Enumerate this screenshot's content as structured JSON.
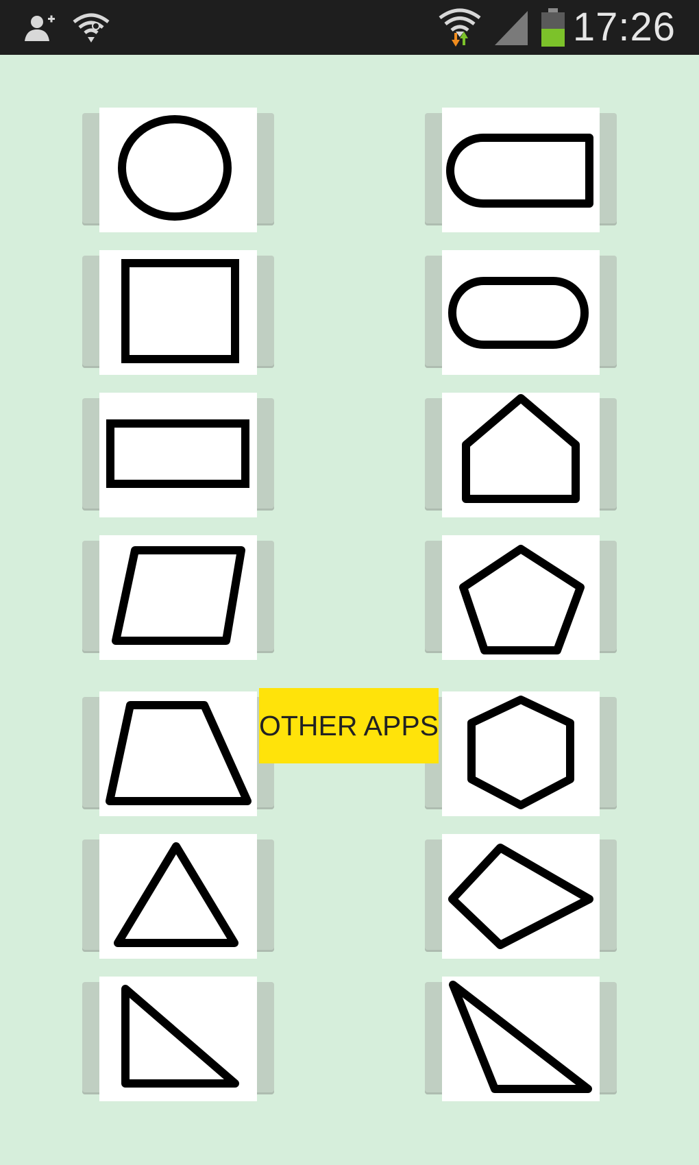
{
  "status_bar": {
    "time": "17:26",
    "icons": [
      "add-user-icon",
      "wifi-share-icon",
      "wifi-data-icon",
      "signal-icon",
      "battery-icon"
    ],
    "colors": {
      "background": "#1e1e1e",
      "battery": "#7cc22a",
      "data_down": "#f08c1e",
      "data_up": "#7cc22a"
    }
  },
  "screen": {
    "background": "#d6eedb"
  },
  "shapes": {
    "left_column": [
      "circle",
      "square",
      "rectangle",
      "parallelogram",
      "trapezoid",
      "triangle",
      "right-triangle"
    ],
    "right_column": [
      "rounded-end-rectangle",
      "stadium",
      "house-pentagon",
      "pentagon",
      "hexagon",
      "kite",
      "obtuse-triangle"
    ]
  },
  "other_apps": {
    "label": "OTHER APPS",
    "color": "#ffe30a"
  }
}
